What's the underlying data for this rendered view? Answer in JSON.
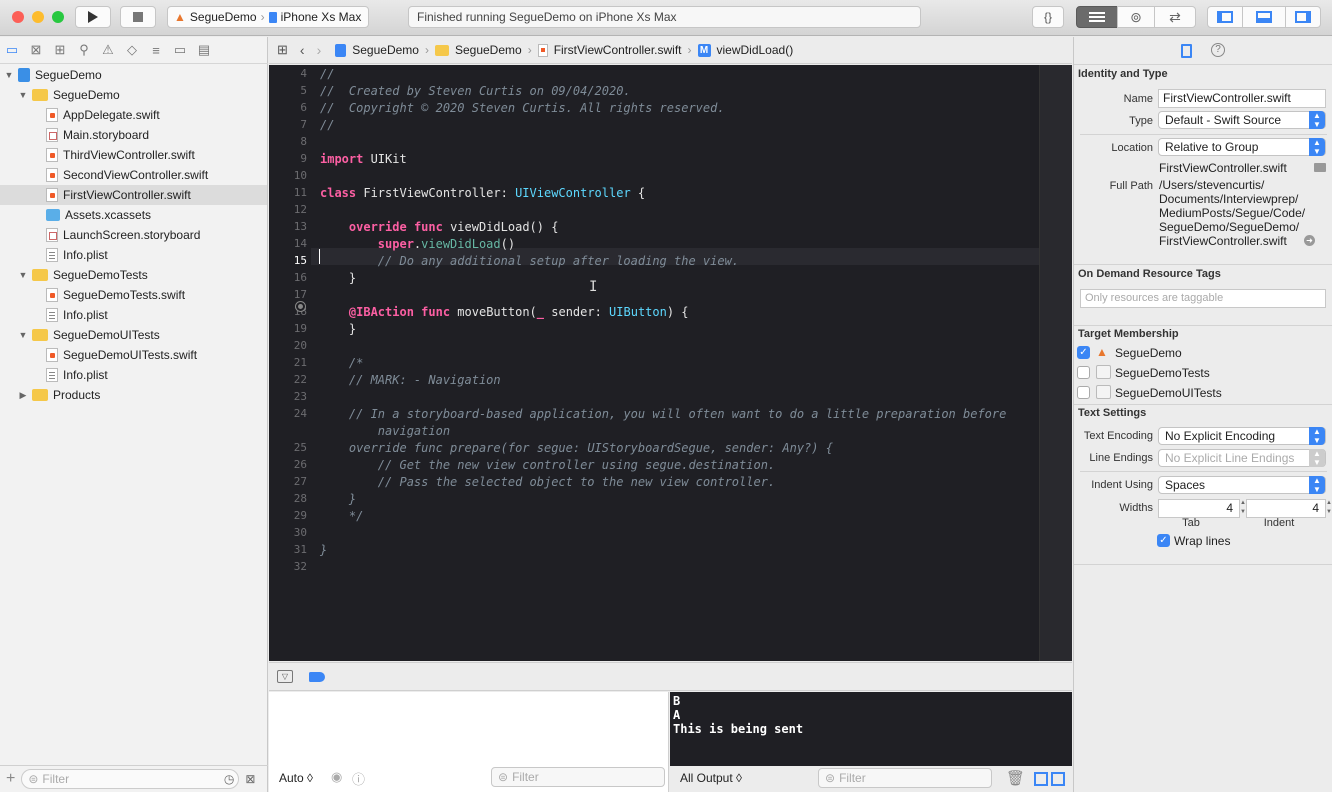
{
  "toolbar": {
    "scheme": "SegueDemo",
    "device": "iPhone Xs Max",
    "status": "Finished running SegueDemo on iPhone Xs Max",
    "braces": "{}"
  },
  "navigator": {
    "items": [
      {
        "label": "SegueDemo",
        "icon": "project-icon"
      },
      {
        "label": "SegueDemo",
        "icon": "folder-icon"
      },
      {
        "label": "AppDelegate.swift",
        "icon": "swift-file-icon"
      },
      {
        "label": "Main.storyboard",
        "icon": "storyboard-icon"
      },
      {
        "label": "ThirdViewController.swift",
        "icon": "swift-file-icon"
      },
      {
        "label": "SecondViewController.swift",
        "icon": "swift-file-icon"
      },
      {
        "label": "FirstViewController.swift",
        "icon": "swift-file-icon"
      },
      {
        "label": "Assets.xcassets",
        "icon": "assets-icon"
      },
      {
        "label": "LaunchScreen.storyboard",
        "icon": "storyboard-icon"
      },
      {
        "label": "Info.plist",
        "icon": "plist-icon"
      },
      {
        "label": "SegueDemoTests",
        "icon": "folder-icon"
      },
      {
        "label": "SegueDemoTests.swift",
        "icon": "swift-file-icon"
      },
      {
        "label": "Info.plist",
        "icon": "plist-icon"
      },
      {
        "label": "SegueDemoUITests",
        "icon": "folder-icon"
      },
      {
        "label": "SegueDemoUITests.swift",
        "icon": "swift-file-icon"
      },
      {
        "label": "Info.plist",
        "icon": "plist-icon"
      },
      {
        "label": "Products",
        "icon": "folder-icon"
      }
    ],
    "filter_placeholder": "Filter"
  },
  "jumpbar": {
    "project": "SegueDemo",
    "group": "SegueDemo",
    "file": "FirstViewController.swift",
    "symbol_badge": "M",
    "symbol": "viewDidLoad()"
  },
  "editor": {
    "current_line": "15",
    "lines": [
      {
        "n": "4",
        "text": "//"
      },
      {
        "n": "5",
        "text": "//  Created by Steven Curtis on 09/04/2020."
      },
      {
        "n": "6",
        "text": "//  Copyright © 2020 Steven Curtis. All rights reserved."
      },
      {
        "n": "7",
        "text": "//"
      },
      {
        "n": "8",
        "text": ""
      },
      {
        "n": "9",
        "text": "import UIKit"
      },
      {
        "n": "10",
        "text": ""
      },
      {
        "n": "11",
        "text": "class FirstViewController: UIViewController {"
      },
      {
        "n": "12",
        "text": ""
      },
      {
        "n": "13",
        "text": "    override func viewDidLoad() {"
      },
      {
        "n": "14",
        "text": "        super.viewDidLoad()"
      },
      {
        "n": "15",
        "text": "        // Do any additional setup after loading the view."
      },
      {
        "n": "16",
        "text": "    }"
      },
      {
        "n": "17",
        "text": ""
      },
      {
        "n": "18",
        "text": "    @IBAction func moveButton(_ sender: UIButton) {"
      },
      {
        "n": "19",
        "text": "    }"
      },
      {
        "n": "20",
        "text": ""
      },
      {
        "n": "21",
        "text": "    /*"
      },
      {
        "n": "22",
        "text": "    // MARK: - Navigation"
      },
      {
        "n": "23",
        "text": ""
      },
      {
        "n": "24",
        "text": "    // In a storyboard-based application, you will often want to do a little preparation before"
      },
      {
        "n": "",
        "text": "        navigation"
      },
      {
        "n": "25",
        "text": "    override func prepare(for segue: UIStoryboardSegue, sender: Any?) {"
      },
      {
        "n": "26",
        "text": "        // Get the new view controller using segue.destination."
      },
      {
        "n": "27",
        "text": "        // Pass the selected object to the new view controller."
      },
      {
        "n": "28",
        "text": "    }"
      },
      {
        "n": "29",
        "text": "    */"
      },
      {
        "n": "30",
        "text": ""
      },
      {
        "n": "31",
        "text": "}"
      },
      {
        "n": "32",
        "text": ""
      }
    ]
  },
  "debug": {
    "auto_label": "Auto ◊",
    "filter_placeholder": "Filter",
    "output_label": "All Output ◊",
    "console_lines": [
      "B",
      "A",
      "This is being sent"
    ]
  },
  "inspector": {
    "identity_header": "Identity and Type",
    "name_label": "Name",
    "name_value": "FirstViewController.swift",
    "type_label": "Type",
    "type_value": "Default - Swift Source",
    "location_label": "Location",
    "location_value": "Relative to Group",
    "location_file": "FirstViewController.swift",
    "fullpath_label": "Full Path",
    "fullpath_lines": [
      "/Users/stevencurtis/",
      "Documents/Interviewprep/",
      "MediumPosts/Segue/Code/",
      "SegueDemo/SegueDemo/",
      "FirstViewController.swift"
    ],
    "odr_header": "On Demand Resource Tags",
    "odr_placeholder": "Only resources are taggable",
    "target_header": "Target Membership",
    "targets": [
      {
        "label": "SegueDemo",
        "checked": true
      },
      {
        "label": "SegueDemoTests",
        "checked": false
      },
      {
        "label": "SegueDemoUITests",
        "checked": false
      }
    ],
    "text_header": "Text Settings",
    "encoding_label": "Text Encoding",
    "encoding_value": "No Explicit Encoding",
    "endings_label": "Line Endings",
    "endings_value": "No Explicit Line Endings",
    "indent_label": "Indent Using",
    "indent_value": "Spaces",
    "widths_label": "Widths",
    "tab_width": "4",
    "indent_width": "4",
    "tab_caption": "Tab",
    "indent_caption": "Indent",
    "wrap_label": "Wrap lines",
    "wrap_checked": true
  },
  "colors": {
    "accent": "#3b86f5",
    "editor_bg": "#1f1f24",
    "keyword": "#fc5fa3",
    "type": "#5dd8ff",
    "comment": "#7f8c98"
  }
}
